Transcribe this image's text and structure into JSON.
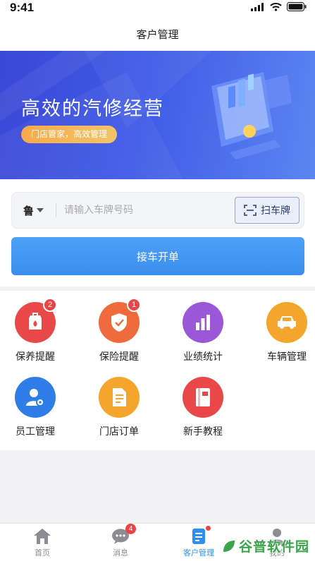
{
  "status_bar": {
    "time": "9:41"
  },
  "header": {
    "title": "客户管理"
  },
  "banner": {
    "title": "高效的汽修经营",
    "subtitle": "门店管家，高效管理",
    "colors": {
      "start": "#3a48d6",
      "end": "#5c86f2",
      "pill": "#f7a94a"
    }
  },
  "plate_form": {
    "province": "鲁",
    "placeholder": "请输入车牌号码",
    "value": "",
    "scan_label": "扫车牌",
    "submit_label": "接车开单"
  },
  "grid": [
    {
      "label": "保养提醒",
      "icon": "maintenance-reminder-icon",
      "color": "#e94848",
      "badge": "2"
    },
    {
      "label": "保险提醒",
      "icon": "insurance-shield-icon",
      "color": "#ef6a3c",
      "badge": "1"
    },
    {
      "label": "业绩统计",
      "icon": "bar-chart-icon",
      "color": "#9a57d8",
      "badge": null
    },
    {
      "label": "车辆管理",
      "icon": "car-icon",
      "color": "#f4a52c",
      "badge": null
    },
    {
      "label": "员工管理",
      "icon": "staff-gear-icon",
      "color": "#2f7ee8",
      "badge": null
    },
    {
      "label": "门店订单",
      "icon": "document-icon",
      "color": "#f4a52c",
      "badge": null
    },
    {
      "label": "新手教程",
      "icon": "book-icon",
      "color": "#e94848",
      "badge": null
    }
  ],
  "tabs": [
    {
      "label": "首页",
      "icon": "home-icon",
      "badge": null,
      "active": false
    },
    {
      "label": "消息",
      "icon": "chat-bubble-icon",
      "badge": "4",
      "active": false
    },
    {
      "label": "客户管理",
      "icon": "clipboard-icon",
      "badge": null,
      "active": true
    },
    {
      "label": "我的",
      "icon": "user-icon",
      "badge": null,
      "active": false
    }
  ],
  "watermark": {
    "text": "谷普软件园"
  },
  "accent_color": "#3c8ef0"
}
